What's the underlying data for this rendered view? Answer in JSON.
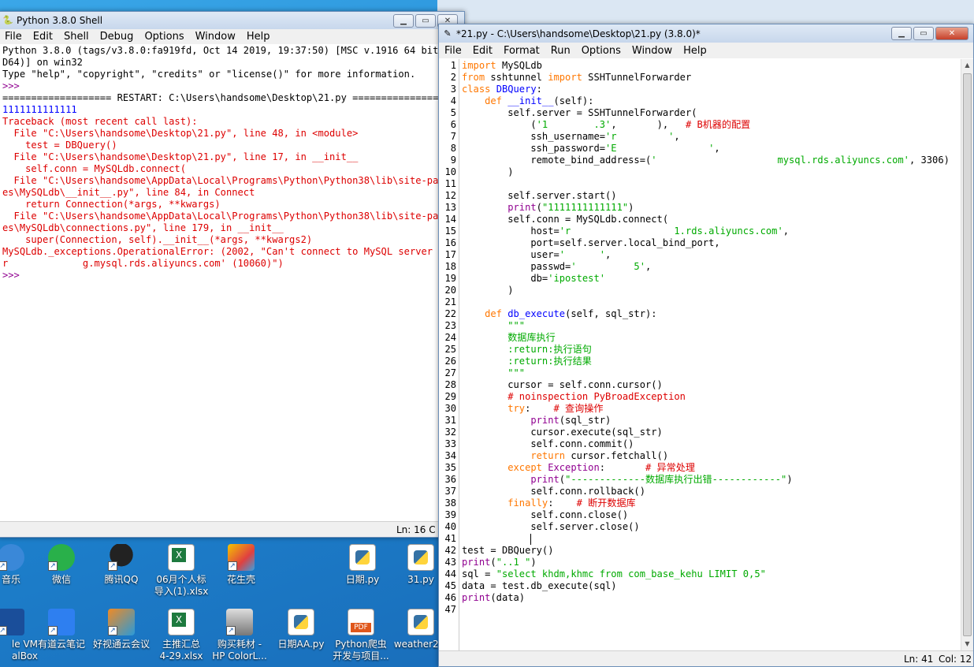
{
  "shell": {
    "title": "Python 3.8.0 Shell",
    "menu": [
      "File",
      "Edit",
      "Shell",
      "Debug",
      "Options",
      "Window",
      "Help"
    ],
    "status": "Ln: 16   C",
    "output": [
      {
        "t": "Python 3.8.0 (tags/v3.8.0:fa919fd, Oct 14 2019, 19:37:50) [MSC v.1916 64 bit (A",
        "c": "o"
      },
      {
        "t": "D64)] on win32",
        "c": "o"
      },
      {
        "t": "Type \"help\", \"copyright\", \"credits\" or \"license()\" for more information.",
        "c": "o"
      },
      {
        "t": ">>> ",
        "c": "b"
      },
      {
        "t": "=================== RESTART: C:\\Users\\handsome\\Desktop\\21.py ==================",
        "c": "o"
      },
      {
        "t": "1111111111111",
        "c": "d"
      },
      {
        "t": "Traceback (most recent call last):",
        "c": "err"
      },
      {
        "t": "  File \"C:\\Users\\handsome\\Desktop\\21.py\", line 48, in <module>",
        "c": "err"
      },
      {
        "t": "    test = DBQuery()",
        "c": "err"
      },
      {
        "t": "  File \"C:\\Users\\handsome\\Desktop\\21.py\", line 17, in __init__",
        "c": "err"
      },
      {
        "t": "    self.conn = MySQLdb.connect(",
        "c": "err"
      },
      {
        "t": "  File \"C:\\Users\\handsome\\AppData\\Local\\Programs\\Python\\Python38\\lib\\site-packa",
        "c": "err"
      },
      {
        "t": "es\\MySQLdb\\__init__.py\", line 84, in Connect",
        "c": "err"
      },
      {
        "t": "    return Connection(*args, **kwargs)",
        "c": "err"
      },
      {
        "t": "  File \"C:\\Users\\handsome\\AppData\\Local\\Programs\\Python\\Python38\\lib\\site-packa",
        "c": "err"
      },
      {
        "t": "es\\MySQLdb\\connections.py\", line 179, in __init__",
        "c": "err"
      },
      {
        "t": "    super(Connection, self).__init__(*args, **kwargs2)",
        "c": "err"
      },
      {
        "t": "MySQLdb._exceptions.OperationalError: (2002, \"Can't connect to MySQL server on",
        "c": "err"
      },
      {
        "t": "r             g.mysql.rds.aliyuncs.com' (10060)\")",
        "c": "err"
      },
      {
        "t": ">>> ",
        "c": "b"
      }
    ]
  },
  "editor": {
    "title": "*21.py - C:\\Users\\handsome\\Desktop\\21.py (3.8.0)*",
    "menu": [
      "File",
      "Edit",
      "Format",
      "Run",
      "Options",
      "Window",
      "Help"
    ],
    "status_ln": "Ln: 41",
    "status_col": "Col: 12",
    "lines": [
      [
        [
          "import",
          "k"
        ],
        [
          " MySQLdb",
          "o"
        ]
      ],
      [
        [
          "from",
          "k"
        ],
        [
          " sshtunnel ",
          "o"
        ],
        [
          "import",
          "k"
        ],
        [
          " SSHTunnelForwarder",
          "o"
        ]
      ],
      [
        [
          "class",
          "k"
        ],
        [
          " ",
          "o"
        ],
        [
          "DBQuery",
          "d"
        ],
        [
          ":",
          "o"
        ]
      ],
      [
        [
          "    ",
          "o"
        ],
        [
          "def",
          "k"
        ],
        [
          " ",
          "o"
        ],
        [
          "__init__",
          "d"
        ],
        [
          "(self):",
          "o"
        ]
      ],
      [
        [
          "        self.server = SSHTunnelForwarder(",
          "o"
        ]
      ],
      [
        [
          "            (",
          "o"
        ],
        [
          "'1        .3'",
          "s"
        ],
        [
          ", ",
          "o"
        ],
        [
          "      ",
          "o"
        ],
        [
          "),   ",
          "o"
        ],
        [
          "# B机器的配置",
          "c"
        ]
      ],
      [
        [
          "            ssh_username=",
          "o"
        ],
        [
          "'r         '",
          "s"
        ],
        [
          ",",
          "o"
        ]
      ],
      [
        [
          "            ssh_password=",
          "o"
        ],
        [
          "'E                '",
          "s"
        ],
        [
          ",",
          "o"
        ]
      ],
      [
        [
          "            remote_bind_address=(",
          "o"
        ],
        [
          "'                     mysql.rds.aliyuncs.com'",
          "s"
        ],
        [
          ", 3306)",
          "o"
        ]
      ],
      [
        [
          "        )",
          "o"
        ]
      ],
      [
        [
          "",
          "o"
        ]
      ],
      [
        [
          "        self.server.start()",
          "o"
        ]
      ],
      [
        [
          "        ",
          "o"
        ],
        [
          "print",
          "b"
        ],
        [
          "(",
          "o"
        ],
        [
          "\"1111111111111\"",
          "s"
        ],
        [
          ")",
          "o"
        ]
      ],
      [
        [
          "        self.conn = MySQLdb.connect(",
          "o"
        ]
      ],
      [
        [
          "            host=",
          "o"
        ],
        [
          "'r                  1.rds.aliyuncs.com'",
          "s"
        ],
        [
          ",",
          "o"
        ]
      ],
      [
        [
          "            port=self.server.local_bind_port,",
          "o"
        ]
      ],
      [
        [
          "            user=",
          "o"
        ],
        [
          "'      '",
          "s"
        ],
        [
          ",",
          "o"
        ]
      ],
      [
        [
          "            passwd=",
          "o"
        ],
        [
          "'          5'",
          "s"
        ],
        [
          ",",
          "o"
        ]
      ],
      [
        [
          "            db=",
          "o"
        ],
        [
          "'ipostest'",
          "s"
        ]
      ],
      [
        [
          "        )",
          "o"
        ]
      ],
      [
        [
          "",
          "o"
        ]
      ],
      [
        [
          "    ",
          "o"
        ],
        [
          "def",
          "k"
        ],
        [
          " ",
          "o"
        ],
        [
          "db_execute",
          "d"
        ],
        [
          "(self, sql_str):",
          "o"
        ]
      ],
      [
        [
          "        ",
          "o"
        ],
        [
          "\"\"\"",
          "s"
        ]
      ],
      [
        [
          "        ",
          "o"
        ],
        [
          "数据库执行",
          "s"
        ]
      ],
      [
        [
          "        ",
          "o"
        ],
        [
          ":return:执行语句",
          "s"
        ]
      ],
      [
        [
          "        ",
          "o"
        ],
        [
          ":return:执行结果",
          "s"
        ]
      ],
      [
        [
          "        ",
          "o"
        ],
        [
          "\"\"\"",
          "s"
        ]
      ],
      [
        [
          "        cursor = self.conn.cursor()",
          "o"
        ]
      ],
      [
        [
          "        ",
          "o"
        ],
        [
          "# noinspection PyBroadException",
          "c"
        ]
      ],
      [
        [
          "        ",
          "o"
        ],
        [
          "try",
          "k"
        ],
        [
          ":    ",
          "o"
        ],
        [
          "# 查询操作",
          "c"
        ]
      ],
      [
        [
          "            ",
          "o"
        ],
        [
          "print",
          "b"
        ],
        [
          "(sql_str)",
          "o"
        ]
      ],
      [
        [
          "            cursor.execute(sql_str)",
          "o"
        ]
      ],
      [
        [
          "            self.conn.commit()",
          "o"
        ]
      ],
      [
        [
          "            ",
          "o"
        ],
        [
          "return",
          "k"
        ],
        [
          " cursor.fetchall()",
          "o"
        ]
      ],
      [
        [
          "        ",
          "o"
        ],
        [
          "except",
          "k"
        ],
        [
          " ",
          "o"
        ],
        [
          "Exception",
          "b"
        ],
        [
          ":       ",
          "o"
        ],
        [
          "# 异常处理",
          "c"
        ]
      ],
      [
        [
          "            ",
          "o"
        ],
        [
          "print",
          "b"
        ],
        [
          "(",
          "o"
        ],
        [
          "\"-------------数据库执行出错------------\"",
          "s"
        ],
        [
          ")",
          "o"
        ]
      ],
      [
        [
          "            self.conn.rollback()",
          "o"
        ]
      ],
      [
        [
          "        ",
          "o"
        ],
        [
          "finally",
          "k"
        ],
        [
          ":    ",
          "o"
        ],
        [
          "# 断开数据库",
          "c"
        ]
      ],
      [
        [
          "            self.conn.close()",
          "o"
        ]
      ],
      [
        [
          "            self.server.close()",
          "o"
        ]
      ],
      [
        [
          "            ",
          "o"
        ]
      ],
      [
        [
          "test = DBQuery()",
          "o"
        ]
      ],
      [
        [
          "print",
          "b"
        ],
        [
          "(",
          "o"
        ],
        [
          "\"..1 \"",
          "s"
        ],
        [
          ")",
          "o"
        ]
      ],
      [
        [
          "sql = ",
          "o"
        ],
        [
          "\"select khdm,khmc from com_base_kehu LIMIT 0,5\"",
          "s"
        ]
      ],
      [
        [
          "data = test.db_execute(sql)",
          "o"
        ]
      ],
      [
        [
          "print",
          "b"
        ],
        [
          "(data)",
          "o"
        ]
      ],
      [
        [
          "",
          "o"
        ]
      ]
    ]
  },
  "desktop_icons_row1": [
    "音乐",
    "微信",
    "腾讯QQ",
    "06月个人标\n导入(1).xlsx",
    "花生壳",
    "",
    "日期.py",
    "31.py"
  ],
  "desktop_icons_row2": [
    "le VM\nalBox",
    "有道云笔记",
    "好视通云会议",
    "主推汇总\n4-29.xlsx",
    "购买耗材 -\nHP ColorL...",
    "日期AA.py",
    "Python爬虫\n开发与项目...",
    "weather2..."
  ]
}
